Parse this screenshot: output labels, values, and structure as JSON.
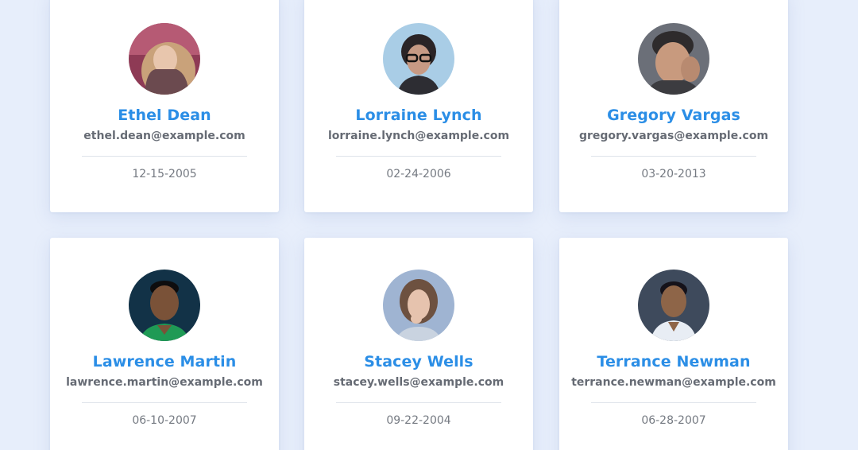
{
  "users": [
    {
      "name": "Ethel Dean",
      "email": "ethel.dean@example.com",
      "date": "12-15-2005"
    },
    {
      "name": "Lorraine Lynch",
      "email": "lorraine.lynch@example.com",
      "date": "02-24-2006"
    },
    {
      "name": "Gregory Vargas",
      "email": "gregory.vargas@example.com",
      "date": "03-20-2013"
    },
    {
      "name": "Lawrence Martin",
      "email": "lawrence.martin@example.com",
      "date": "06-10-2007"
    },
    {
      "name": "Stacey Wells",
      "email": "stacey.wells@example.com",
      "date": "09-22-2004"
    },
    {
      "name": "Terrance Newman",
      "email": "terrance.newman@example.com",
      "date": "06-28-2007"
    }
  ],
  "colors": {
    "background": "#e7eefb",
    "card": "#ffffff",
    "name_accent": "#2b8ee6",
    "email_text": "#666b74",
    "date_text": "#757a82"
  }
}
